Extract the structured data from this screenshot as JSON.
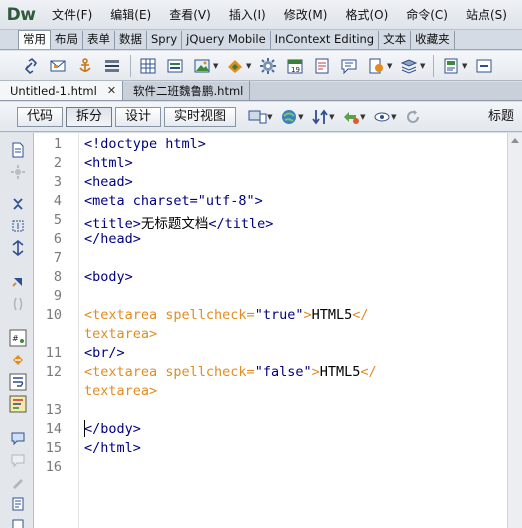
{
  "app": {
    "logo": "Dw"
  },
  "menu": [
    "文件(F)",
    "编辑(E)",
    "查看(V)",
    "插入(I)",
    "修改(M)",
    "格式(O)",
    "命令(C)",
    "站点(S)"
  ],
  "insert_tabs": {
    "items": [
      "常用",
      "布局",
      "表单",
      "数据",
      "Spry",
      "jQuery Mobile",
      "InContext Editing",
      "文本",
      "收藏夹"
    ],
    "active": "常用"
  },
  "insert_icons": [
    "hyperlink-icon",
    "email-link-icon",
    "named-anchor-icon",
    "horizontal-rule-icon",
    "table-icon",
    "insert-div-icon",
    "images-icon",
    "media-icon",
    "widget-icon",
    "date-icon",
    "server-side-include-icon",
    "comment-icon",
    "head-icon",
    "script-icon",
    "templates-icon",
    "tag-chooser-icon"
  ],
  "documents": {
    "tabs": [
      "Untitled-1.html",
      "软件二班魏鲁鹏.html"
    ],
    "active": "Untitled-1.html"
  },
  "view_buttons": {
    "code": "代码",
    "split": "拆分",
    "design": "设计",
    "live": "实时视图",
    "active": "拆分"
  },
  "doc_toolbar": {
    "title_label": "标题"
  },
  "editor": {
    "line_numbers": [
      "1",
      "2",
      "3",
      "4",
      "5",
      "6",
      "7",
      "8",
      "9",
      "10",
      "",
      "11",
      "12",
      "",
      "13",
      "14",
      "15",
      "16"
    ],
    "lines": [
      {
        "segments": [
          {
            "t": "<!doctype html>",
            "c": "navy"
          }
        ]
      },
      {
        "segments": [
          {
            "t": "<html>",
            "c": "navy"
          }
        ]
      },
      {
        "segments": [
          {
            "t": "<head>",
            "c": "navy"
          }
        ]
      },
      {
        "segments": [
          {
            "t": "<meta charset=\"utf-8\">",
            "c": "navy"
          }
        ]
      },
      {
        "segments": [
          {
            "t": "<title>",
            "c": "navy"
          },
          {
            "t": "无标题文档",
            "c": "black"
          },
          {
            "t": "</title>",
            "c": "navy"
          }
        ]
      },
      {
        "segments": [
          {
            "t": "</head>",
            "c": "navy"
          }
        ]
      },
      {
        "segments": []
      },
      {
        "segments": [
          {
            "t": "<body>",
            "c": "navy"
          }
        ]
      },
      {
        "segments": []
      },
      {
        "segments": [
          {
            "t": "<textarea spellcheck=",
            "c": "orange"
          },
          {
            "t": "\"true\"",
            "c": "navy"
          },
          {
            "t": ">",
            "c": "orange"
          },
          {
            "t": "HTML5",
            "c": "black"
          },
          {
            "t": "</",
            "c": "orange"
          }
        ]
      },
      {
        "segments": [
          {
            "t": "textarea>",
            "c": "orange"
          }
        ]
      },
      {
        "segments": [
          {
            "t": "<br/>",
            "c": "navy"
          }
        ]
      },
      {
        "segments": [
          {
            "t": "<textarea spellcheck=",
            "c": "orange"
          },
          {
            "t": "\"false\"",
            "c": "navy"
          },
          {
            "t": ">",
            "c": "orange"
          },
          {
            "t": "HTML5",
            "c": "black"
          },
          {
            "t": "</",
            "c": "orange"
          }
        ]
      },
      {
        "segments": [
          {
            "t": "textarea>",
            "c": "orange"
          }
        ]
      },
      {
        "segments": []
      },
      {
        "segments": [
          {
            "t": "</body>",
            "c": "navy"
          }
        ]
      },
      {
        "segments": [
          {
            "t": "</html>",
            "c": "navy"
          }
        ]
      },
      {
        "segments": []
      }
    ]
  },
  "colors": {
    "tag": "#000080",
    "textarea_tag": "#e48b1f",
    "text": "#000000",
    "line_number": "#7a7a7a"
  }
}
